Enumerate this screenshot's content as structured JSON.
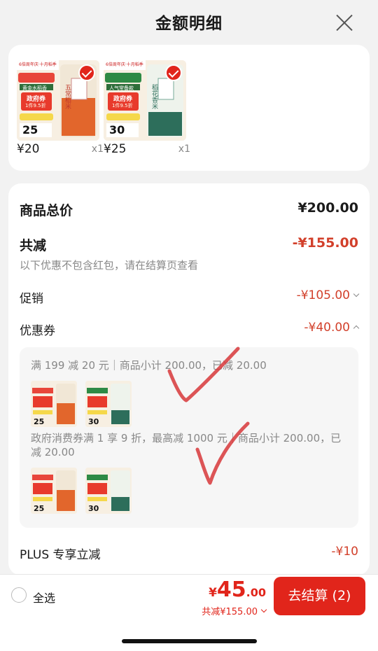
{
  "header": {
    "title": "金额明细"
  },
  "products": [
    {
      "price": "¥20",
      "qty": "x1",
      "badge_top": "6倍周年庆·十月稻季",
      "tag": "黄金水稻香",
      "coupon": "政府券",
      "discount": "1件9.5折",
      "pack_price": "25",
      "pack_unit": ".00",
      "brand": "五常稻米"
    },
    {
      "price": "¥25",
      "qty": "x1",
      "badge_top": "6倍周年庆·十月稻季",
      "tag": "人气常备款",
      "coupon": "政府券",
      "discount": "1件9.5折",
      "pack_price": "30",
      "pack_unit": ".00",
      "brand": "稻花香米"
    }
  ],
  "summary": {
    "goods_total_label": "商品总价",
    "goods_total_value": "¥200.00",
    "reduce_label": "共减",
    "reduce_value": "-¥155.00",
    "reduce_note": "以下优惠不包含红包，请在结算页查看",
    "promo_label": "促销",
    "promo_value": "-¥105.00",
    "coupon_label": "优惠券",
    "coupon_value": "-¥40.00",
    "plus_label": "PLUS 专享立减",
    "plus_value": "-¥10"
  },
  "coupons": [
    {
      "text": "满 199 减 20 元｜商品小计 200.00，已减 20.00"
    },
    {
      "text": "政府消费券满 1 享 9 折，最高减 1000 元｜商品小计 200.00，已减 20.00"
    }
  ],
  "footer": {
    "select_all": "全选",
    "currency": "¥",
    "total_int": "45",
    "total_dec": ".00",
    "total_reduce": "共减¥155.00",
    "checkout": "去结算 (2)"
  },
  "colors": {
    "accent": "#e1251b",
    "background": "#f2f2f2"
  }
}
